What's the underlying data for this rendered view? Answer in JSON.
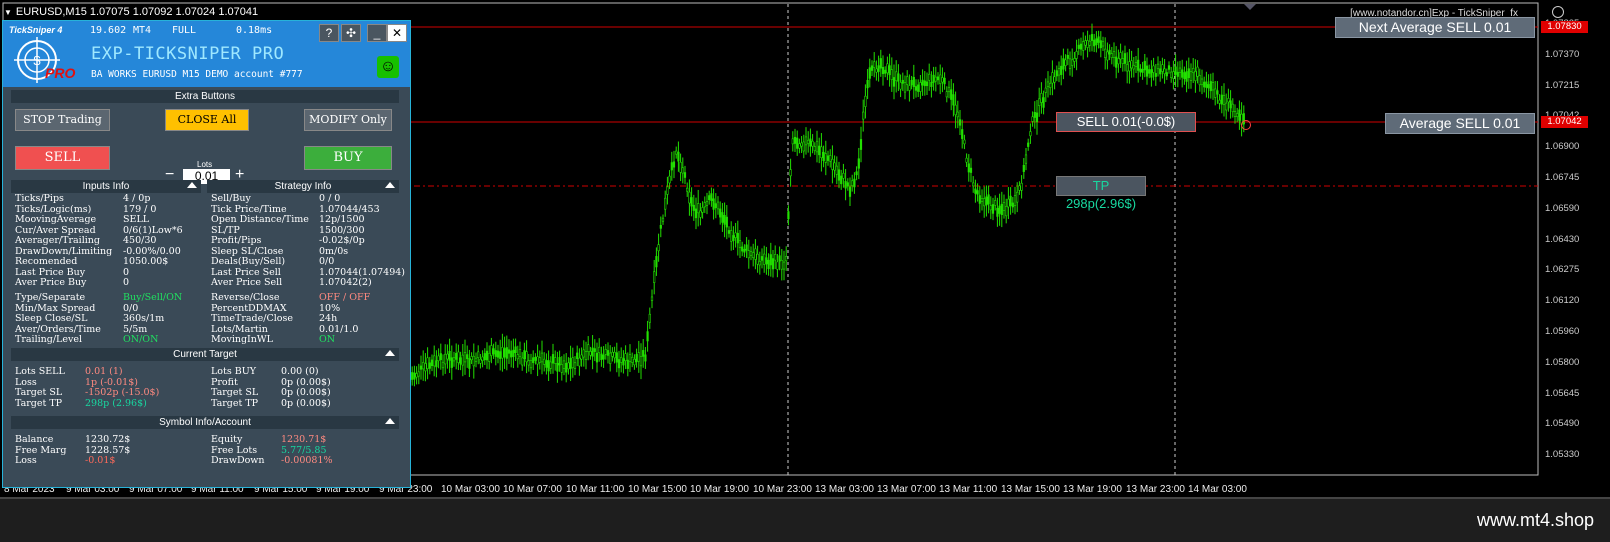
{
  "chart": {
    "title": "EURUSD,M15  1.07075 1.07092 1.07024 1.07041",
    "watermark": "[www.notandor.cn]Exp - TickSniper_fx",
    "site": "www.mt4.shop",
    "price_labels": [
      "1.07825",
      "1.07370",
      "1.07215",
      "1.07042",
      "1.06900",
      "1.06745",
      "1.06590",
      "1.06430",
      "1.06275",
      "1.06120",
      "1.05960",
      "1.05800",
      "1.05645",
      "1.05490",
      "1.05330"
    ],
    "price_marker_top": "1.07830",
    "price_marker_mid": "1.07042",
    "time_labels": [
      "8 Mar 2023",
      "9 Mar 03:00",
      "9 Mar 07:00",
      "9 Mar 11:00",
      "9 Mar 15:00",
      "9 Mar 19:00",
      "9 Mar 23:00",
      "10 Mar 03:00",
      "10 Mar 07:00",
      "10 Mar 11:00",
      "10 Mar 15:00",
      "10 Mar 19:00",
      "10 Mar 23:00",
      "13 Mar 03:00",
      "13 Mar 07:00",
      "13 Mar 11:00",
      "13 Mar 15:00",
      "13 Mar 19:00",
      "13 Mar 23:00",
      "14 Mar 03:00"
    ],
    "next_avg_sell": "Next Average SELL 0.01",
    "avg_sell": "Average SELL 0.01",
    "sell_order": "SELL 0.01(-0.0$)",
    "tp_order": "TP 298p(2.96$)",
    "colors": {
      "candle": "#22e000",
      "line": "#d00000",
      "tp_line": "#d00000",
      "grid": "#cccccc"
    }
  },
  "panel": {
    "mini_title": "TickSniper 4",
    "logo_badge": "PRO",
    "stat1": "19.602",
    "stat2": "MT4",
    "stat3": "FULL",
    "stat4": "0.18ms",
    "help": "?",
    "pin": "✣",
    "minimize": "_",
    "close": "✕",
    "title": "EXP-TICKSNIPER PRO",
    "account": "BA WORKS EURUSD  M15 DEMO account   #777",
    "smiley": "☺",
    "extra_buttons": "Extra Buttons",
    "stop_trading": "STOP Trading",
    "close_all": "CLOSE All",
    "modify_only": "MODIFY Only",
    "sell": "SELL",
    "buy": "BUY",
    "lots_label": "Lots",
    "lots_value": "0.01",
    "minus": "−",
    "plus": "+",
    "inputs_info": "Inputs Info",
    "strategy_info": "Strategy Info",
    "current_target": "Current Target",
    "symbol_info": "Symbol Info/Account",
    "inputs": [
      [
        "Ticks/Pips",
        "4 / 0p"
      ],
      [
        "Ticks/Logic(ms)",
        "179 / 0"
      ],
      [
        "MoovingAverage",
        "SELL"
      ],
      [
        "Cur/Aver Spread",
        "0/6(1)Low*6"
      ],
      [
        "Averager/Trailing",
        "450/30"
      ],
      [
        "DrawDown/Limiting",
        "-0.00%/0.00"
      ],
      [
        "Recomended",
        "1050.00$"
      ],
      [
        "Last Price Buy",
        "0"
      ],
      [
        "Aver Price Buy",
        "0"
      ]
    ],
    "strategy": [
      [
        "Sell/Buy",
        "0 / 0"
      ],
      [
        "Tick Price/Time",
        "1.07044/453"
      ],
      [
        "Open Distance/Time",
        "12p/1500"
      ],
      [
        "SL/TP",
        "1500/300"
      ],
      [
        "Profit/Pips",
        "-0.02$/0p"
      ],
      [
        "Sleep SL/Close",
        "0m/0s"
      ],
      [
        "Deals(Buy/Sell)",
        "0/0"
      ],
      [
        "Last Price Sell",
        "1.07044(1.07494)"
      ],
      [
        "Aver Price Sell",
        "1.07042(2)"
      ]
    ],
    "inputs2": [
      [
        "Type/Separate",
        "Buy/Sell/ON"
      ],
      [
        "Min/Max Spread",
        "0/0"
      ],
      [
        "Sleep Close/SL",
        "360s/1m"
      ],
      [
        "Aver/Orders/Time",
        "5/5m"
      ],
      [
        "Trailing/Level",
        "ON/ON"
      ]
    ],
    "strategy2": [
      [
        "Reverse/Close",
        "OFF / OFF"
      ],
      [
        "PercentDDMAX",
        "10%"
      ],
      [
        "TimeTrade/Close",
        "24h"
      ],
      [
        "Lots/Martin",
        "0.01/1.0"
      ],
      [
        "MovingInWL",
        "ON"
      ]
    ],
    "target_left": [
      [
        "Lots SELL",
        "0.01 (1)"
      ],
      [
        "Loss",
        "1p (-0.01$)"
      ],
      [
        "Target SL",
        "-1502p (-15.0$)"
      ],
      [
        "Target TP",
        "298p (2.96$)"
      ]
    ],
    "target_right": [
      [
        "Lots BUY",
        "0.00 (0)"
      ],
      [
        "Profit",
        "0p (0.00$)"
      ],
      [
        "Target SL",
        "0p (0.00$)"
      ],
      [
        "Target TP",
        "0p (0.00$)"
      ]
    ],
    "account_left": [
      [
        "Balance",
        "1230.72$"
      ],
      [
        "Free Marg",
        "1228.57$"
      ],
      [
        "Loss",
        "-0.01$"
      ]
    ],
    "account_right": [
      [
        "Equity",
        "1230.71$"
      ],
      [
        "Free Lots",
        "5.77/5.85"
      ],
      [
        "DrawDown",
        "-0.00081%"
      ]
    ]
  }
}
